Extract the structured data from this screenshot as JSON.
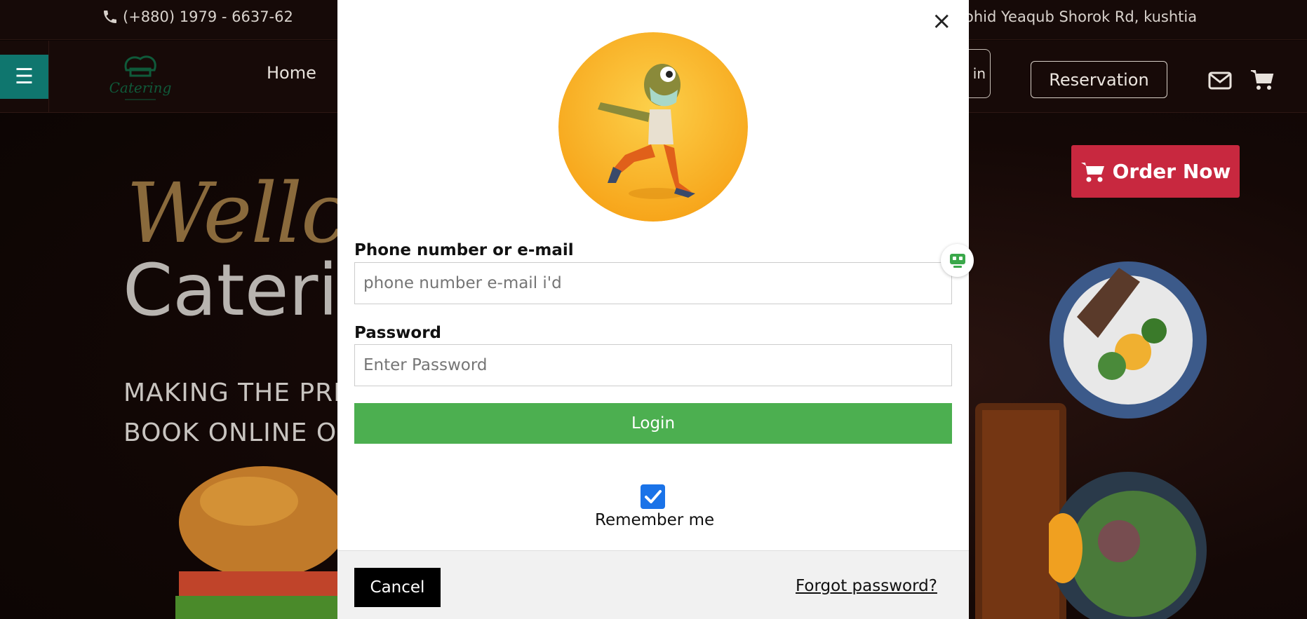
{
  "topbar": {
    "phone": "(+880) 1979 - 6637-62",
    "address": "ohid Yeaqub Shorok Rd, kushtia"
  },
  "navbar": {
    "menu_icon": "☰",
    "logo_text": "Catering",
    "home_label": "Home",
    "login_partial": "in",
    "reservation_label": "Reservation"
  },
  "hero": {
    "script": "Wellcom",
    "title": "Caterir",
    "sub_line1": "MAKING THE PRE",
    "sub_line2": "BOOK ONLINE OF",
    "order_label": "Order Now"
  },
  "modal": {
    "close_label": "×",
    "username_label": "Phone number or e-mail",
    "username_placeholder": "phone number e-mail i'd",
    "password_label": "Password",
    "password_placeholder": "Enter Password",
    "login_label": "Login",
    "remember_label": "Remember me",
    "remember_checked": true,
    "cancel_label": "Cancel",
    "forgot_label": "Forgot password?"
  },
  "colors": {
    "accent_teal": "#0f766e",
    "login_green": "#4caf50",
    "order_red": "#c8283f",
    "checkbox_blue": "#1a73e8"
  },
  "icons": [
    "phone-icon",
    "menu-icon",
    "mail-icon",
    "cart-icon",
    "close-icon",
    "check-icon",
    "helper-widget-icon"
  ]
}
